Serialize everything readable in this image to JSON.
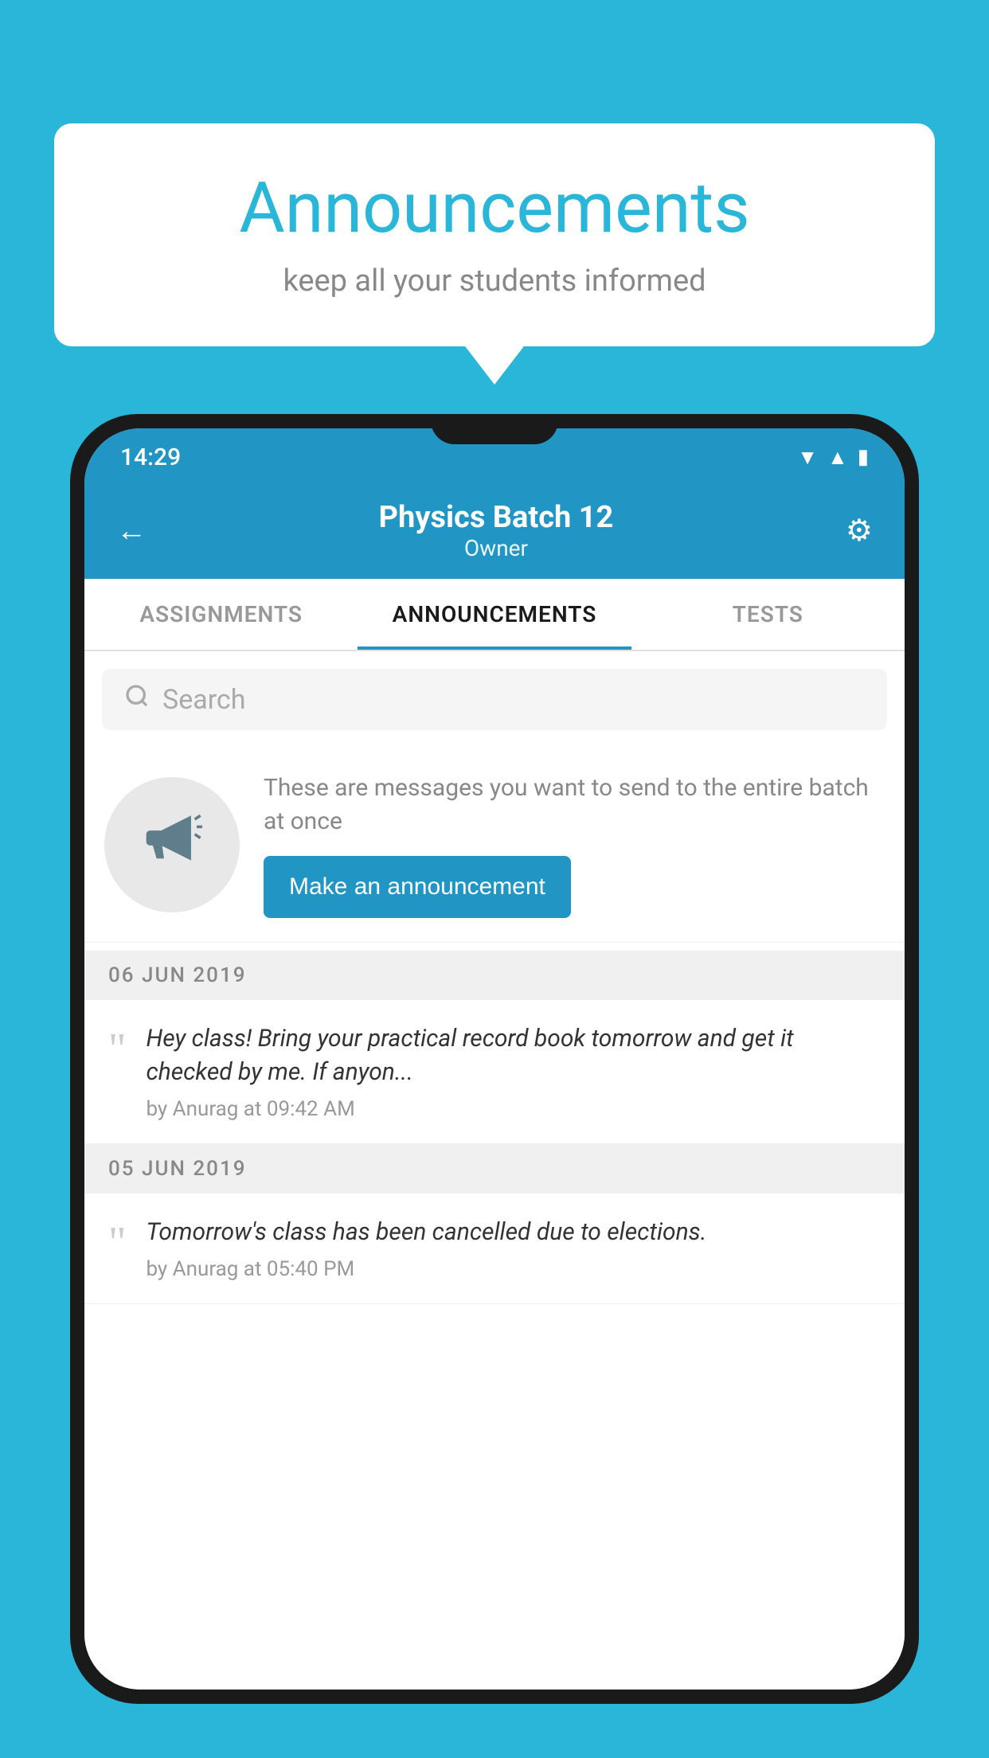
{
  "background_color": "#29b6d8",
  "speech_bubble": {
    "title": "Announcements",
    "subtitle": "keep all your students informed"
  },
  "phone": {
    "status_bar": {
      "time": "14:29"
    },
    "header": {
      "title": "Physics Batch 12",
      "subtitle": "Owner",
      "back_label": "←",
      "settings_label": "⚙"
    },
    "tabs": [
      {
        "label": "ASSIGNMENTS",
        "active": false
      },
      {
        "label": "ANNOUNCEMENTS",
        "active": true
      },
      {
        "label": "TESTS",
        "active": false
      }
    ],
    "search": {
      "placeholder": "Search"
    },
    "announcement_prompt": {
      "description_text": "These are messages you want to send to the entire batch at once",
      "button_label": "Make an announcement"
    },
    "announcements": [
      {
        "date": "06  JUN  2019",
        "text": "Hey class! Bring your practical record book tomorrow and get it checked by me. If anyon...",
        "meta": "by Anurag at 09:42 AM"
      },
      {
        "date": "05  JUN  2019",
        "text": "Tomorrow's class has been cancelled due to elections.",
        "meta": "by Anurag at 05:40 PM"
      }
    ]
  }
}
